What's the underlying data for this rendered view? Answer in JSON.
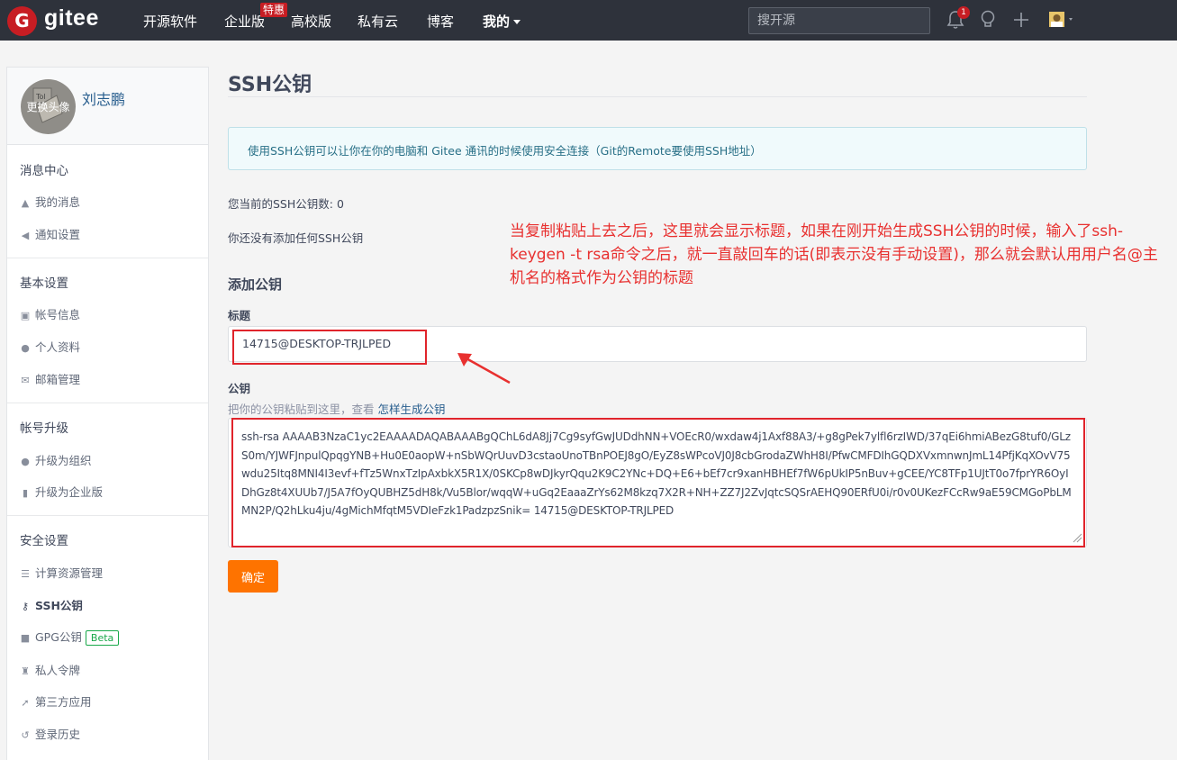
{
  "header": {
    "logo_letter": "G",
    "brand": "gitee",
    "nav": {
      "open_source": "开源软件",
      "enterprise": "企业版",
      "enterprise_badge": "特惠",
      "university": "高校版",
      "private_cloud": "私有云",
      "blog": "博客",
      "mine": "我的"
    },
    "search_placeholder": "搜开源",
    "notification_count": "1"
  },
  "sidebar": {
    "avatar_label": "更换头像",
    "username": "刘志鹏",
    "sections": {
      "messages": {
        "title": "消息中心",
        "items": [
          "我的消息",
          "通知设置"
        ]
      },
      "basic": {
        "title": "基本设置",
        "items": [
          "帐号信息",
          "个人资料",
          "邮箱管理"
        ]
      },
      "upgrade": {
        "title": "帐号升级",
        "items": [
          "升级为组织",
          "升级为企业版"
        ]
      },
      "security": {
        "title": "安全设置",
        "items": [
          "计算资源管理",
          "SSH公钥",
          "GPG公钥",
          "私人令牌",
          "第三方应用",
          "登录历史"
        ],
        "beta_label": "Beta"
      }
    }
  },
  "main": {
    "title": "SSH公钥",
    "info": "使用SSH公钥可以让你在你的电脑和 Gitee 通讯的时候使用安全连接（Git的Remote要使用SSH地址）",
    "key_count": "您当前的SSH公钥数: 0",
    "no_keys": "你还没有添加任何SSH公钥",
    "add_title": "添加公钥",
    "title_label": "标题",
    "title_value": "14715@DESKTOP-TRJLPED",
    "key_label": "公钥",
    "key_hint": "把你的公钥粘贴到这里，查看 ",
    "key_hint_link": "怎样生成公钥",
    "key_value": "ssh-rsa AAAAB3NzaC1yc2EAAAADAQABAAABgQChL6dA8Jj7Cg9syfGwJUDdhNN+VOEcR0/wxdaw4j1Axf88A3/+g8gPek7ylfl6rzIWD/37qEi6hmiABezG8tuf0/GLzS0m/YJWFJnpulQpqgYNB+Hu0E0aopW+nSbWQrUuvD3cstaoUnoTBnPOEJ8gO/EyZ8sWPcoVJ0J8cbGrodaZWhH8I/PfwCMFDIhGQDXVxmnwnJmL14PfjKqXOvV75wdu25Itq8MNI4I3evf+fTz5WnxTzIpAxbkX5R1X/0SKCp8wDJkyrQqu2K9C2YNc+DQ+E6+bEf7cr9xanHBHEf7fW6pUkIP5nBuv+gCEE/YC8TFp1UJtT0o7fprYR6OyIDhGz8t4XUUb7/J5A7fOyQUBHZ5dH8k/Vu5Blor/wqqW+uGq2EaaaZrYs62M8kzq7X2R+NH+ZZ7J2ZvJqtcSQSrAEHQ90ERfU0i/r0v0UKezFCcRw9aE59CMGoPbLMMN2P/Q2hLku4ju/4gMichMfqtM5VDIeFzk1PadzpzSnik= 14715@DESKTOP-TRJLPED",
    "confirm": "确定",
    "annotation": "当复制粘贴上去之后，这里就会显示标题，如果在刚开始生成SSH公钥的时候，输入了ssh-keygen -t rsa命令之后，就一直敲回车的话(即表示没有手动设置)，那么就会默认用用户名@主机名的格式作为公钥的标题"
  },
  "colors": {
    "header_bg": "#2e323b",
    "brand_red": "#c71d23",
    "button_orange": "#fe7300",
    "annotation_red": "#e8302f",
    "link_blue": "#285e8e",
    "beta_green": "#19a84a"
  }
}
